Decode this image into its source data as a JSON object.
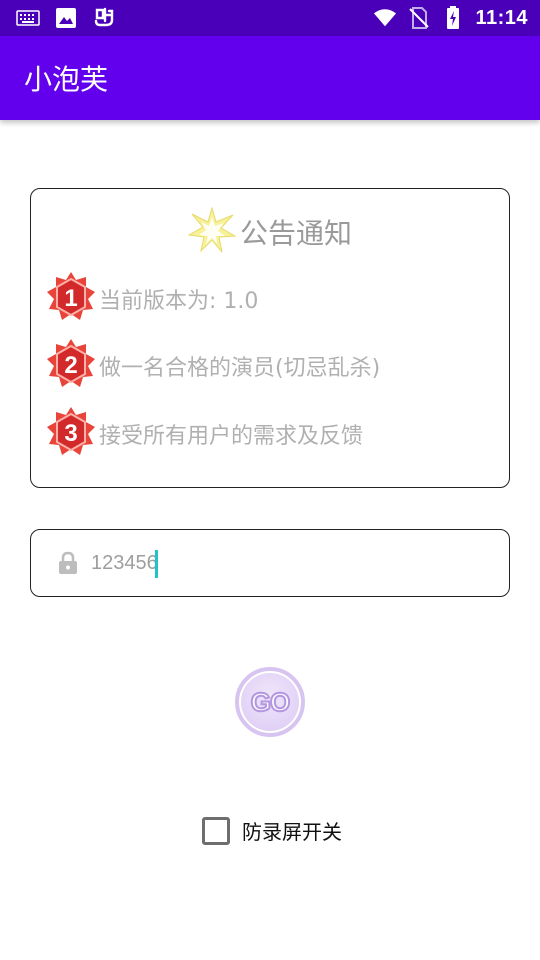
{
  "status_bar": {
    "time": "11:14",
    "icons": [
      "keyboard-icon",
      "image-icon",
      "app-notify-icon",
      "wifi-icon",
      "no-sim-icon",
      "battery-charging-icon"
    ]
  },
  "app_bar": {
    "title": "小泡芙"
  },
  "notice": {
    "title": "公告通知",
    "items": [
      {
        "number": "1",
        "text": "当前版本为: 1.0"
      },
      {
        "number": "2",
        "text": "做一名合格的演员(切忌乱杀)"
      },
      {
        "number": "3",
        "text": "接受所有用户的需求及反馈"
      }
    ]
  },
  "password": {
    "value": "123456",
    "icon": "lock-icon"
  },
  "go_button": {
    "label": "GO"
  },
  "anti_record": {
    "label": "防录屏开关",
    "checked": false
  },
  "colors": {
    "status_bar": "#4a00b8",
    "app_bar": "#6200ee",
    "caret": "#1fc3c8",
    "badge_red": "#e8443a"
  }
}
